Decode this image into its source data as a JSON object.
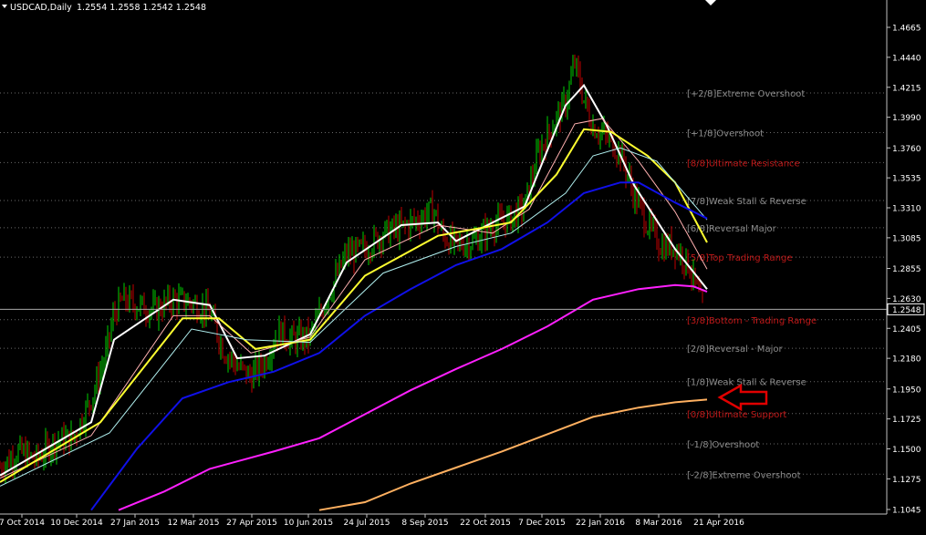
{
  "window": {
    "symbol_label": "USDCAD,Daily",
    "ohlc_label": "1.2554 1.2558 1.2542 1.2548",
    "current_price_label": "1.2548"
  },
  "colors": {
    "background": "#000000",
    "axis": "#c0c0c0",
    "text": "#ffffff",
    "bull_candle": "#00d000",
    "bear_candle": "#c00000",
    "murrey_grey": "#8c8c8c",
    "murrey_red": "#c01818",
    "ma_white": "#ffffff",
    "ma_yellow": "#ffff30",
    "ma_pink": "#ffb0b0",
    "ma_cyan": "#b0f0f0",
    "ma_blue": "#1010e8",
    "ma_magenta": "#ff20ff",
    "ma_orange": "#ffb060",
    "arrow": "#e00000"
  },
  "annotation": {
    "type": "arrow-left-outline",
    "icon": "red-arrow-icon"
  },
  "chart_data": {
    "type": "candlestick",
    "title": "USDCAD,Daily",
    "symbol": "USDCAD",
    "timeframe": "Daily",
    "last_ohlc": {
      "open": 1.2554,
      "high": 1.2558,
      "low": 1.2542,
      "close": 1.2548
    },
    "ylim": [
      1.1045,
      1.4665
    ],
    "y_ticks": [
      1.4665,
      1.444,
      1.4215,
      1.399,
      1.376,
      1.3535,
      1.331,
      1.3085,
      1.2855,
      1.263,
      1.2405,
      1.218,
      1.195,
      1.1725,
      1.15,
      1.1275,
      1.1045
    ],
    "x_ticks": [
      "7 Oct 2014",
      "10 Dec 2014",
      "27 Jan 2015",
      "12 Mar 2015",
      "27 Apr 2015",
      "10 Jun 2015",
      "24 Jul 2015",
      "8 Sep 2015",
      "22 Oct 2015",
      "7 Dec 2015",
      "22 Jan 2016",
      "8 Mar 2016",
      "21 Apr 2016"
    ],
    "xlim_index": [
      0,
      1000
    ],
    "x_tick_index": [
      24,
      84,
      148,
      212,
      276,
      338,
      402,
      466,
      532,
      594,
      658,
      722,
      788
    ],
    "grid": false,
    "legend": "none",
    "murrey_levels": [
      {
        "label": "[+2/8]Extreme Overshoot",
        "price": 1.4172,
        "style": "grey"
      },
      {
        "label": "[+1/8]Overshoot",
        "price": 1.3875,
        "style": "grey"
      },
      {
        "label": "[8/8]Ultimate Resistance",
        "price": 1.365,
        "style": "red"
      },
      {
        "label": "[7/8]Weak Stall & Reverse",
        "price": 1.3365,
        "style": "grey"
      },
      {
        "label": "[6/8]Reversal Major",
        "price": 1.316,
        "style": "grey"
      },
      {
        "label": "[5/8]Top Trading Range",
        "price": 1.294,
        "style": "red"
      },
      {
        "label": "[3/8]Bottom - Trading Range",
        "price": 1.247,
        "style": "red"
      },
      {
        "label": "[2/8]Reversal - Major",
        "price": 1.2255,
        "style": "grey"
      },
      {
        "label": "[1/8]Weak Stall & Reverse",
        "price": 1.2005,
        "style": "grey"
      },
      {
        "label": "[0/8]Ultimate Support",
        "price": 1.1765,
        "style": "red"
      },
      {
        "label": "[-1/8]Overshoot",
        "price": 1.1538,
        "style": "grey"
      },
      {
        "label": "[-2/8]Extreme Overshoot",
        "price": 1.131,
        "style": "grey"
      }
    ],
    "current_price": 1.2548,
    "price_path": [
      [
        0,
        1.136
      ],
      [
        20,
        1.148
      ],
      [
        40,
        1.142
      ],
      [
        60,
        1.156
      ],
      [
        80,
        1.158
      ],
      [
        100,
        1.188
      ],
      [
        115,
        1.218
      ],
      [
        125,
        1.252
      ],
      [
        135,
        1.262
      ],
      [
        150,
        1.258
      ],
      [
        170,
        1.254
      ],
      [
        190,
        1.262
      ],
      [
        210,
        1.26
      ],
      [
        230,
        1.252
      ],
      [
        245,
        1.224
      ],
      [
        260,
        1.212
      ],
      [
        275,
        1.204
      ],
      [
        290,
        1.216
      ],
      [
        305,
        1.238
      ],
      [
        320,
        1.232
      ],
      [
        340,
        1.234
      ],
      [
        360,
        1.266
      ],
      [
        380,
        1.296
      ],
      [
        400,
        1.3
      ],
      [
        420,
        1.312
      ],
      [
        440,
        1.316
      ],
      [
        460,
        1.323
      ],
      [
        475,
        1.33
      ],
      [
        485,
        1.31
      ],
      [
        500,
        1.303
      ],
      [
        520,
        1.306
      ],
      [
        540,
        1.318
      ],
      [
        560,
        1.323
      ],
      [
        575,
        1.332
      ],
      [
        590,
        1.372
      ],
      [
        605,
        1.392
      ],
      [
        620,
        1.41
      ],
      [
        630,
        1.44
      ],
      [
        640,
        1.412
      ],
      [
        650,
        1.392
      ],
      [
        665,
        1.384
      ],
      [
        680,
        1.372
      ],
      [
        695,
        1.341
      ],
      [
        710,
        1.318
      ],
      [
        725,
        1.302
      ],
      [
        740,
        1.302
      ],
      [
        755,
        1.288
      ],
      [
        770,
        1.255
      ]
    ],
    "series": [
      {
        "color_key": "ma_white",
        "values": [
          [
            0,
            1.13
          ],
          [
            100,
            1.17
          ],
          [
            125,
            1.232
          ],
          [
            190,
            1.262
          ],
          [
            230,
            1.258
          ],
          [
            260,
            1.218
          ],
          [
            290,
            1.22
          ],
          [
            340,
            1.236
          ],
          [
            380,
            1.29
          ],
          [
            440,
            1.318
          ],
          [
            480,
            1.32
          ],
          [
            500,
            1.306
          ],
          [
            540,
            1.32
          ],
          [
            575,
            1.332
          ],
          [
            620,
            1.408
          ],
          [
            640,
            1.423
          ],
          [
            665,
            1.393
          ],
          [
            695,
            1.348
          ],
          [
            740,
            1.3
          ],
          [
            775,
            1.27
          ]
        ]
      },
      {
        "color_key": "ma_pink",
        "values": [
          [
            0,
            1.128
          ],
          [
            100,
            1.16
          ],
          [
            190,
            1.25
          ],
          [
            230,
            1.25
          ],
          [
            275,
            1.222
          ],
          [
            340,
            1.234
          ],
          [
            400,
            1.292
          ],
          [
            480,
            1.318
          ],
          [
            540,
            1.312
          ],
          [
            580,
            1.33
          ],
          [
            630,
            1.394
          ],
          [
            660,
            1.398
          ],
          [
            700,
            1.366
          ],
          [
            740,
            1.328
          ],
          [
            775,
            1.285
          ]
        ]
      },
      {
        "color_key": "ma_yellow",
        "values": [
          [
            0,
            1.125
          ],
          [
            110,
            1.17
          ],
          [
            200,
            1.248
          ],
          [
            240,
            1.248
          ],
          [
            280,
            1.225
          ],
          [
            340,
            1.232
          ],
          [
            400,
            1.28
          ],
          [
            480,
            1.31
          ],
          [
            560,
            1.32
          ],
          [
            610,
            1.356
          ],
          [
            640,
            1.39
          ],
          [
            670,
            1.388
          ],
          [
            710,
            1.37
          ],
          [
            740,
            1.35
          ],
          [
            775,
            1.305
          ]
        ]
      },
      {
        "color_key": "ma_cyan",
        "values": [
          [
            0,
            1.122
          ],
          [
            120,
            1.162
          ],
          [
            210,
            1.24
          ],
          [
            270,
            1.232
          ],
          [
            340,
            1.23
          ],
          [
            420,
            1.282
          ],
          [
            500,
            1.302
          ],
          [
            560,
            1.312
          ],
          [
            620,
            1.342
          ],
          [
            650,
            1.37
          ],
          [
            680,
            1.376
          ],
          [
            720,
            1.366
          ],
          [
            775,
            1.322
          ]
        ]
      },
      {
        "color_key": "ma_blue",
        "values": [
          [
            100,
            1.104
          ],
          [
            150,
            1.15
          ],
          [
            200,
            1.188
          ],
          [
            250,
            1.2
          ],
          [
            300,
            1.208
          ],
          [
            350,
            1.222
          ],
          [
            400,
            1.25
          ],
          [
            450,
            1.27
          ],
          [
            500,
            1.288
          ],
          [
            550,
            1.3
          ],
          [
            600,
            1.32
          ],
          [
            640,
            1.342
          ],
          [
            680,
            1.35
          ],
          [
            700,
            1.35
          ],
          [
            740,
            1.335
          ],
          [
            775,
            1.323
          ]
        ]
      },
      {
        "color_key": "ma_magenta",
        "values": [
          [
            130,
            1.104
          ],
          [
            180,
            1.118
          ],
          [
            230,
            1.135
          ],
          [
            300,
            1.148
          ],
          [
            350,
            1.158
          ],
          [
            400,
            1.176
          ],
          [
            450,
            1.194
          ],
          [
            500,
            1.21
          ],
          [
            550,
            1.225
          ],
          [
            600,
            1.242
          ],
          [
            650,
            1.262
          ],
          [
            700,
            1.27
          ],
          [
            740,
            1.273
          ],
          [
            760,
            1.272
          ],
          [
            775,
            1.268
          ]
        ]
      },
      {
        "color_key": "ma_orange",
        "values": [
          [
            350,
            1.104
          ],
          [
            400,
            1.11
          ],
          [
            450,
            1.124
          ],
          [
            500,
            1.136
          ],
          [
            550,
            1.148
          ],
          [
            600,
            1.161
          ],
          [
            650,
            1.174
          ],
          [
            700,
            1.181
          ],
          [
            740,
            1.185
          ],
          [
            775,
            1.187
          ]
        ]
      }
    ]
  }
}
